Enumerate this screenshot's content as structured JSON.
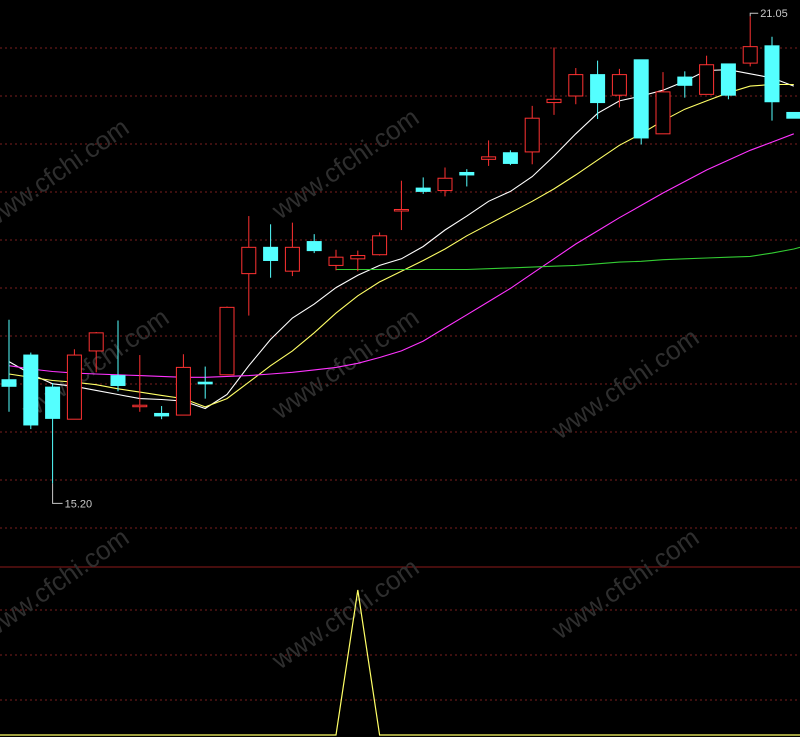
{
  "watermark": "www.cfchi.com",
  "colors": {
    "background": "#000000",
    "up_candle": "#ff3232",
    "down_candle": "#54ffff",
    "grid": "#7a1e1e",
    "panel_divider": "#8b1a1a",
    "ma5": "#ffffff",
    "ma10": "#ffff66",
    "ma20": "#ff33ff",
    "ma60": "#33cc33",
    "indicator": "#ffff66",
    "label": "#c8c8c8"
  },
  "chart_data": {
    "type": "candlestick",
    "price_range": [
      14.9,
      21.15
    ],
    "annotations": {
      "high": "21.05",
      "low": "15.20"
    },
    "candles": [
      {
        "o": 16.63,
        "h": 17.36,
        "l": 16.24,
        "c": 16.55
      },
      {
        "o": 16.93,
        "h": 16.96,
        "l": 16.03,
        "c": 16.08
      },
      {
        "o": 16.54,
        "h": 16.59,
        "l": 15.37,
        "c": 16.16
      },
      {
        "o": 16.15,
        "h": 17.0,
        "l": 16.15,
        "c": 16.93
      },
      {
        "o": 16.98,
        "h": 17.21,
        "l": 16.72,
        "c": 17.2
      },
      {
        "o": 16.68,
        "h": 17.35,
        "l": 16.49,
        "c": 16.56
      },
      {
        "o": 16.32,
        "h": 16.93,
        "l": 16.24,
        "c": 16.32
      },
      {
        "o": 16.22,
        "h": 16.31,
        "l": 16.15,
        "c": 16.19
      },
      {
        "o": 16.2,
        "h": 16.94,
        "l": 16.2,
        "c": 16.78
      },
      {
        "o": 16.6,
        "h": 16.79,
        "l": 16.4,
        "c": 16.58
      },
      {
        "o": 16.69,
        "h": 17.52,
        "l": 16.69,
        "c": 17.51
      },
      {
        "o": 17.92,
        "h": 18.62,
        "l": 17.41,
        "c": 18.24
      },
      {
        "o": 18.24,
        "h": 18.52,
        "l": 17.87,
        "c": 18.08
      },
      {
        "o": 17.95,
        "h": 18.54,
        "l": 17.89,
        "c": 18.24
      },
      {
        "o": 18.31,
        "h": 18.4,
        "l": 18.17,
        "c": 18.2
      },
      {
        "o": 18.02,
        "h": 18.21,
        "l": 17.96,
        "c": 18.12
      },
      {
        "o": 18.1,
        "h": 18.2,
        "l": 17.95,
        "c": 18.14
      },
      {
        "o": 18.15,
        "h": 18.42,
        "l": 18.14,
        "c": 18.38
      },
      {
        "o": 18.69,
        "h": 19.05,
        "l": 18.45,
        "c": 18.7
      },
      {
        "o": 18.96,
        "h": 19.09,
        "l": 18.89,
        "c": 18.92
      },
      {
        "o": 18.93,
        "h": 19.21,
        "l": 18.86,
        "c": 19.08
      },
      {
        "o": 19.15,
        "h": 19.19,
        "l": 18.98,
        "c": 19.12
      },
      {
        "o": 19.31,
        "h": 19.54,
        "l": 19.23,
        "c": 19.34
      },
      {
        "o": 19.39,
        "h": 19.42,
        "l": 19.24,
        "c": 19.26
      },
      {
        "o": 19.4,
        "h": 19.96,
        "l": 19.25,
        "c": 19.81
      },
      {
        "o": 20.0,
        "h": 20.67,
        "l": 19.85,
        "c": 20.04
      },
      {
        "o": 20.08,
        "h": 20.42,
        "l": 19.98,
        "c": 20.34
      },
      {
        "o": 20.34,
        "h": 20.51,
        "l": 19.8,
        "c": 20.0
      },
      {
        "o": 20.09,
        "h": 20.41,
        "l": 19.94,
        "c": 20.34
      },
      {
        "o": 20.52,
        "h": 20.52,
        "l": 19.49,
        "c": 19.57
      },
      {
        "o": 19.62,
        "h": 20.37,
        "l": 19.62,
        "c": 20.13
      },
      {
        "o": 20.31,
        "h": 20.38,
        "l": 20.06,
        "c": 20.21
      },
      {
        "o": 20.1,
        "h": 20.57,
        "l": 20.1,
        "c": 20.46
      },
      {
        "o": 20.47,
        "h": 20.47,
        "l": 20.04,
        "c": 20.09
      },
      {
        "o": 20.48,
        "h": 21.05,
        "l": 20.44,
        "c": 20.68
      },
      {
        "o": 20.69,
        "h": 20.8,
        "l": 19.78,
        "c": 20.01
      },
      {
        "o": 19.88,
        "h": 19.88,
        "l": 19.81,
        "c": 19.81
      }
    ],
    "ma_lines": [
      {
        "key": "ma5",
        "values": [
          16.85,
          16.7,
          16.58,
          16.55,
          16.5,
          16.45,
          16.4,
          16.39,
          16.37,
          16.28,
          16.45,
          16.8,
          17.12,
          17.38,
          17.55,
          17.75,
          17.9,
          18.02,
          18.1,
          18.25,
          18.45,
          18.62,
          18.8,
          18.92,
          19.1,
          19.35,
          19.62,
          19.87,
          20.02,
          20.08,
          20.15,
          20.26,
          20.39,
          20.4,
          20.35,
          20.3,
          20.2
        ]
      },
      {
        "key": "ma10",
        "values": [
          16.7,
          16.66,
          16.62,
          16.6,
          16.57,
          16.52,
          16.48,
          16.44,
          16.4,
          16.3,
          16.4,
          16.6,
          16.8,
          16.98,
          17.2,
          17.44,
          17.65,
          17.82,
          17.95,
          18.08,
          18.22,
          18.38,
          18.52,
          18.66,
          18.8,
          18.95,
          19.12,
          19.3,
          19.48,
          19.62,
          19.78,
          19.92,
          20.02,
          20.12,
          20.2,
          20.22,
          20.22
        ]
      },
      {
        "key": "ma20",
        "values": [
          16.8,
          16.76,
          16.73,
          16.71,
          16.7,
          16.69,
          16.68,
          16.67,
          16.66,
          16.66,
          16.67,
          16.68,
          16.7,
          16.72,
          16.75,
          16.78,
          16.83,
          16.9,
          16.98,
          17.1,
          17.26,
          17.42,
          17.58,
          17.74,
          17.92,
          18.1,
          18.28,
          18.44,
          18.6,
          18.75,
          18.9,
          19.04,
          19.18,
          19.3,
          19.42,
          19.52,
          19.62
        ]
      },
      {
        "key": "ma60",
        "start": 15,
        "values": [
          17.97,
          17.97,
          17.97,
          17.97,
          17.97,
          17.97,
          17.97,
          17.98,
          17.99,
          18.0,
          18.01,
          18.02,
          18.04,
          18.06,
          18.07,
          18.09,
          18.1,
          18.11,
          18.12,
          18.13,
          18.17,
          18.22,
          18.29
        ]
      }
    ],
    "indicator": {
      "range": [
        0,
        1
      ],
      "values": [
        0,
        0,
        0,
        0,
        0,
        0,
        0,
        0,
        0,
        0,
        0,
        0,
        0,
        0,
        0,
        0,
        1,
        0,
        0,
        0,
        0,
        0,
        0,
        0,
        0,
        0,
        0,
        0,
        0,
        0,
        0,
        0,
        0,
        0,
        0,
        0,
        0
      ]
    }
  }
}
